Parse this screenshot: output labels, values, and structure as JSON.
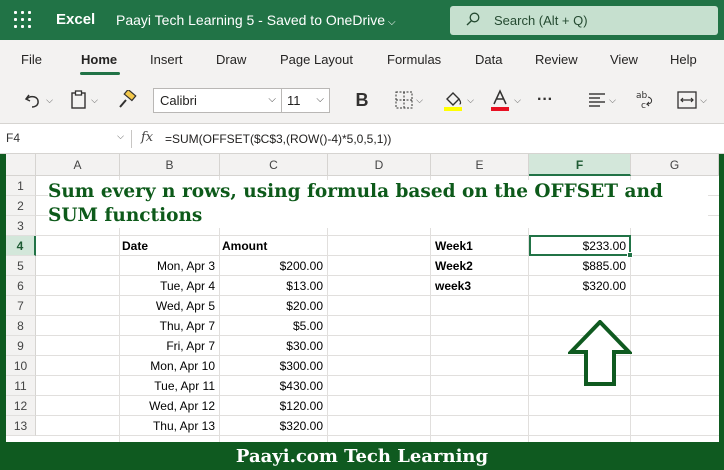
{
  "titlebar": {
    "app_name": "Excel",
    "doc_title": "Paayi Tech Learning 5  -  Saved to OneDrive",
    "doc_chevron": "⌵",
    "search_placeholder": "Search (Alt + Q)"
  },
  "menu": {
    "tabs": [
      {
        "label": "File"
      },
      {
        "label": "Home"
      },
      {
        "label": "Insert"
      },
      {
        "label": "Draw"
      },
      {
        "label": "Page Layout"
      },
      {
        "label": "Formulas"
      },
      {
        "label": "Data"
      },
      {
        "label": "Review"
      },
      {
        "label": "View"
      },
      {
        "label": "Help"
      }
    ],
    "active_tab": "Home"
  },
  "ribbon": {
    "font_name": "Calibri",
    "font_size": "11",
    "bold_label": "B",
    "more_label": "···",
    "accent_fill": "#ffff00",
    "accent_font": "#e81123",
    "icons": [
      "undo-icon",
      "paste-icon",
      "format-painter-icon",
      "bold-icon",
      "borders-icon",
      "fill-color-icon",
      "font-color-icon",
      "more-icon",
      "align-icon",
      "wrap-text-icon",
      "merge-icon"
    ]
  },
  "formula_bar": {
    "name_box": "F4",
    "fx": "fx",
    "formula": "=SUM(OFFSET($C$3,(ROW()-4)*5,0,5,1))"
  },
  "grid": {
    "columns": [
      "A",
      "B",
      "C",
      "D",
      "E",
      "F",
      "G"
    ],
    "selected_column": "F",
    "rows": [
      "1",
      "2",
      "3",
      "4",
      "5",
      "6",
      "7",
      "8",
      "9",
      "10",
      "11",
      "12",
      "13"
    ],
    "selected_row": "4",
    "heading": "Sum every n rows, using formula based on the OFFSET and SUM functions",
    "table_headers": {
      "date": "Date",
      "amount": "Amount"
    },
    "records": [
      {
        "date": "Mon, Apr 3",
        "amount": "$200.00"
      },
      {
        "date": "Tue, Apr 4",
        "amount": "$13.00"
      },
      {
        "date": "Wed, Apr 5",
        "amount": "$20.00"
      },
      {
        "date": "Thu, Apr 7",
        "amount": "$5.00"
      },
      {
        "date": "Fri, Apr 7",
        "amount": "$30.00"
      },
      {
        "date": "Mon, Apr 10",
        "amount": "$300.00"
      },
      {
        "date": "Tue, Apr 11",
        "amount": "$430.00"
      },
      {
        "date": "Wed, Apr 12",
        "amount": "$120.00"
      },
      {
        "date": "Thu, Apr 13",
        "amount": "$320.00"
      }
    ],
    "summary": [
      {
        "label": "Week1",
        "value": "$233.00"
      },
      {
        "label": "Week2",
        "value": "$885.00"
      },
      {
        "label": "week3",
        "value": "$320.00"
      }
    ],
    "arrow_color": "#0f5a20"
  },
  "footer": {
    "text": "Paayi.com Tech Learning"
  },
  "colors": {
    "brand_green": "#217346",
    "frame_green": "#0f5a20",
    "heading_green": "#0d5a1a"
  }
}
